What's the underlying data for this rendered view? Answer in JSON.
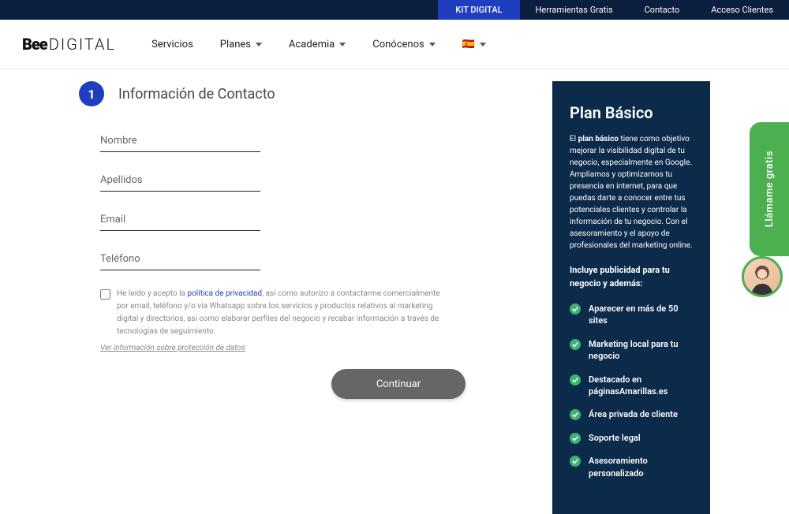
{
  "topbar": {
    "kit": "KIT DIGITAL",
    "links": [
      "Herramientas Gratis",
      "Contacto",
      "Acceso Clientes"
    ]
  },
  "logo": {
    "bee": "Bee",
    "digital": "DIGITAL"
  },
  "nav": {
    "servicios": "Servicios",
    "planes": "Planes",
    "academia": "Academia",
    "conocenos": "Conócenos",
    "flag": "🇪🇸"
  },
  "step": {
    "num": "1",
    "title": "Información de Contacto"
  },
  "fields": {
    "nombre": "Nombre",
    "apellidos": "Apellidos",
    "email": "Email",
    "telefono": "Teléfono"
  },
  "legal": {
    "pre": " He leído y acepto la ",
    "policy": "política de privacidad",
    "post": ", así como autorizo a contactarme comercialmente por email, teléfono y/o vía Whatsapp sobre los servicios y productos relativos al marketing digital y directorios, así como elaborar perfiles del negocio y recabar información a través de tecnologías de seguimiento.",
    "info": "Ver información sobre protección de datos"
  },
  "continue": "Continuar",
  "sidebar": {
    "title": "Plan Básico",
    "desc_pre": "El ",
    "desc_bold": "plan básico",
    "desc_post": " tiene como objetivo mejorar la visibilidad digital de tu negocio, especialmente en Google. Ampliamos y optimizamos tu presencia en internet, para que puedas darte a conocer entre tus potenciales clientes y controlar la información de tu negocio. Con el asesoramiento y el apoyo de profesionales del marketing online.",
    "subhead": "Incluye publicidad para tu negocio y además:",
    "features": [
      "Aparecer en más de 50 sites",
      "Marketing local para tu negocio",
      "Destacado en páginasAmarillas.es",
      "Área privada de cliente",
      "Soporte legal",
      "Asesoramiento personalizado"
    ]
  },
  "call": "Llámame gratis"
}
